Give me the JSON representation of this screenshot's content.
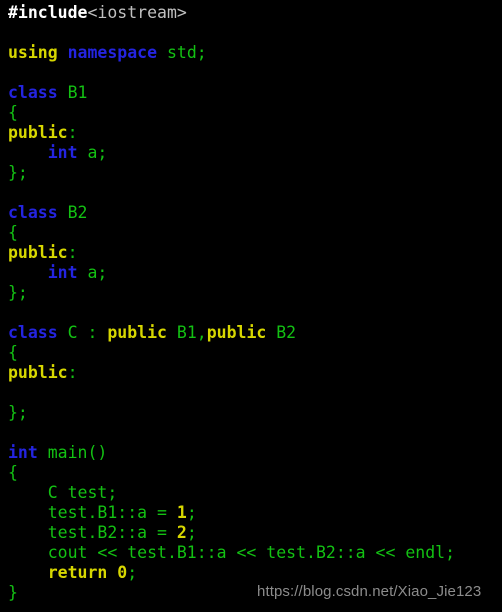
{
  "editor": {
    "language": "cpp",
    "background_color": "#000000",
    "colors": {
      "preprocessor": "#ffffff",
      "header": "#c0c0c0",
      "keyword": "#2424e0",
      "keyword_alt": "#d7d700",
      "identifier": "#13c113",
      "number": "#d7d700",
      "watermark": "#8c8c8c"
    },
    "lines": [
      {
        "n": 1,
        "tokens": [
          {
            "text": "#include",
            "style": "t-pre"
          },
          {
            "text": "<iostream>",
            "style": "t-hdr"
          }
        ]
      },
      {
        "n": 2,
        "tokens": []
      },
      {
        "n": 3,
        "tokens": [
          {
            "text": "using",
            "style": "t-kw2"
          },
          {
            "text": " ",
            "style": "t-id"
          },
          {
            "text": "namespace",
            "style": "t-kw"
          },
          {
            "text": " std;",
            "style": "t-id"
          }
        ]
      },
      {
        "n": 4,
        "tokens": []
      },
      {
        "n": 5,
        "tokens": [
          {
            "text": "class",
            "style": "t-kw"
          },
          {
            "text": " B1",
            "style": "t-id"
          }
        ]
      },
      {
        "n": 6,
        "tokens": [
          {
            "text": "{",
            "style": "t-id"
          }
        ]
      },
      {
        "n": 7,
        "tokens": [
          {
            "text": "public",
            "style": "t-kw2"
          },
          {
            "text": ":",
            "style": "t-id"
          }
        ]
      },
      {
        "n": 8,
        "tokens": [
          {
            "text": "    ",
            "style": "t-id"
          },
          {
            "text": "int",
            "style": "t-kw"
          },
          {
            "text": " a;",
            "style": "t-id"
          }
        ]
      },
      {
        "n": 9,
        "tokens": [
          {
            "text": "};",
            "style": "t-id"
          }
        ]
      },
      {
        "n": 10,
        "tokens": []
      },
      {
        "n": 11,
        "tokens": [
          {
            "text": "class",
            "style": "t-kw"
          },
          {
            "text": " B2",
            "style": "t-id"
          }
        ]
      },
      {
        "n": 12,
        "tokens": [
          {
            "text": "{",
            "style": "t-id"
          }
        ]
      },
      {
        "n": 13,
        "tokens": [
          {
            "text": "public",
            "style": "t-kw2"
          },
          {
            "text": ":",
            "style": "t-id"
          }
        ]
      },
      {
        "n": 14,
        "tokens": [
          {
            "text": "    ",
            "style": "t-id"
          },
          {
            "text": "int",
            "style": "t-kw"
          },
          {
            "text": " a;",
            "style": "t-id"
          }
        ]
      },
      {
        "n": 15,
        "tokens": [
          {
            "text": "};",
            "style": "t-id"
          }
        ]
      },
      {
        "n": 16,
        "tokens": []
      },
      {
        "n": 17,
        "tokens": [
          {
            "text": "class",
            "style": "t-kw"
          },
          {
            "text": " C : ",
            "style": "t-id"
          },
          {
            "text": "public",
            "style": "t-kw2"
          },
          {
            "text": " B1,",
            "style": "t-id"
          },
          {
            "text": "public",
            "style": "t-kw2"
          },
          {
            "text": " B2",
            "style": "t-id"
          }
        ]
      },
      {
        "n": 18,
        "tokens": [
          {
            "text": "{",
            "style": "t-id"
          }
        ]
      },
      {
        "n": 19,
        "tokens": [
          {
            "text": "public",
            "style": "t-kw2"
          },
          {
            "text": ":",
            "style": "t-id"
          }
        ]
      },
      {
        "n": 20,
        "tokens": []
      },
      {
        "n": 21,
        "tokens": [
          {
            "text": "};",
            "style": "t-id"
          }
        ]
      },
      {
        "n": 22,
        "tokens": []
      },
      {
        "n": 23,
        "tokens": [
          {
            "text": "int",
            "style": "t-kw"
          },
          {
            "text": " main()",
            "style": "t-id"
          }
        ]
      },
      {
        "n": 24,
        "tokens": [
          {
            "text": "{",
            "style": "t-id"
          }
        ]
      },
      {
        "n": 25,
        "tokens": [
          {
            "text": "    C test;",
            "style": "t-id"
          }
        ]
      },
      {
        "n": 26,
        "tokens": [
          {
            "text": "    test.B1::a = ",
            "style": "t-id"
          },
          {
            "text": "1",
            "style": "t-num"
          },
          {
            "text": ";",
            "style": "t-id"
          }
        ]
      },
      {
        "n": 27,
        "tokens": [
          {
            "text": "    test.B2::a = ",
            "style": "t-id"
          },
          {
            "text": "2",
            "style": "t-num"
          },
          {
            "text": ";",
            "style": "t-id"
          }
        ]
      },
      {
        "n": 28,
        "tokens": [
          {
            "text": "    cout << test.B1::a << test.B2::a << endl;",
            "style": "t-id"
          }
        ]
      },
      {
        "n": 29,
        "tokens": [
          {
            "text": "    ",
            "style": "t-id"
          },
          {
            "text": "return",
            "style": "t-kw2"
          },
          {
            "text": " ",
            "style": "t-id"
          },
          {
            "text": "0",
            "style": "t-num"
          },
          {
            "text": ";",
            "style": "t-id"
          }
        ]
      },
      {
        "n": 30,
        "tokens": [
          {
            "text": "}",
            "style": "t-id"
          }
        ]
      }
    ]
  },
  "watermark": {
    "text": "https://blog.csdn.net/Xiao_Jie123"
  }
}
